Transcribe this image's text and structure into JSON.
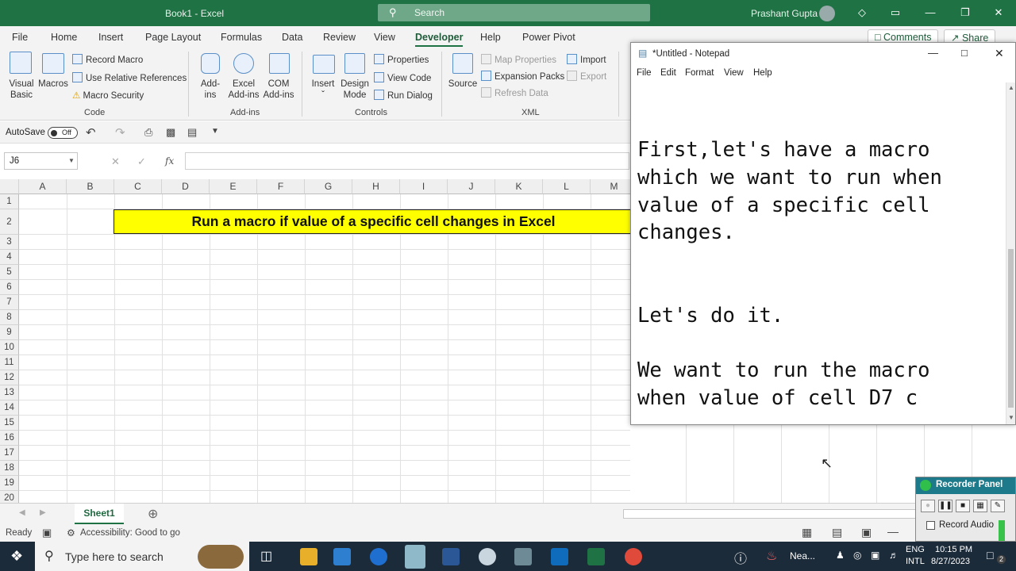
{
  "excel": {
    "window_title": "Book1 - Excel",
    "search_placeholder": "Search",
    "user_name": "Prashant Gupta",
    "tabs": [
      "File",
      "Home",
      "Insert",
      "Page Layout",
      "Formulas",
      "Data",
      "Review",
      "View",
      "Developer",
      "Help",
      "Power Pivot"
    ],
    "active_tab": "Developer",
    "comments_label": "Comments",
    "share_label": "Share",
    "ribbon": {
      "code": {
        "visual_basic": "Visual Basic",
        "macros": "Macros",
        "record_macro": "Record Macro",
        "use_relative": "Use Relative References",
        "macro_security": "Macro Security",
        "group": "Code"
      },
      "addins": {
        "addins": "Add-ins",
        "excel_addins": "Excel Add-ins",
        "com_addins": "COM Add-ins",
        "group": "Add-ins"
      },
      "controls": {
        "insert": "Insert",
        "design_mode": "Design Mode",
        "properties": "Properties",
        "view_code": "View Code",
        "run_dialog": "Run Dialog",
        "group": "Controls"
      },
      "xml": {
        "source": "Source",
        "map_properties": "Map Properties",
        "expansion_packs": "Expansion Packs",
        "refresh_data": "Refresh Data",
        "import": "Import",
        "export": "Export",
        "group": "XML"
      }
    },
    "autosave_label": "AutoSave",
    "autosave_state": "Off",
    "name_box": "J6",
    "fx_label": "fx",
    "columns": [
      "A",
      "B",
      "C",
      "D",
      "E",
      "F",
      "G",
      "H",
      "I",
      "J",
      "K",
      "L",
      "M"
    ],
    "rows": [
      "1",
      "2",
      "3",
      "4",
      "5",
      "6",
      "7",
      "8",
      "9",
      "10",
      "11",
      "12",
      "13",
      "14",
      "15",
      "16",
      "17",
      "18",
      "19",
      "20"
    ],
    "banner_text": "Run a macro if value of a specific cell changes in Excel",
    "sheet_tab": "Sheet1",
    "status_ready": "Ready",
    "accessibility": "Accessibility: Good to go"
  },
  "notepad": {
    "title": "*Untitled - Notepad",
    "menu": [
      "File",
      "Edit",
      "Format",
      "View",
      "Help"
    ],
    "text": "First,let's have a macro\nwhich we want to run when\nvalue of a specific cell\nchanges.\n\n\nLet's do it.\n\nWe want to run the macro\nwhen value of cell D7 c"
  },
  "recorder": {
    "title": "Recorder Panel",
    "record_audio": "Record Audio"
  },
  "taskbar": {
    "search_placeholder": "Type here to search",
    "weather": "Nea...",
    "lang_top": "ENG",
    "lang_bottom": "INTL",
    "time": "10:15 PM",
    "date": "8/27/2023",
    "notif_count": "2"
  },
  "colors": {
    "excel_green": "#1f7244",
    "banner_yellow": "#ffff00",
    "taskbar": "#1c2b3a"
  }
}
